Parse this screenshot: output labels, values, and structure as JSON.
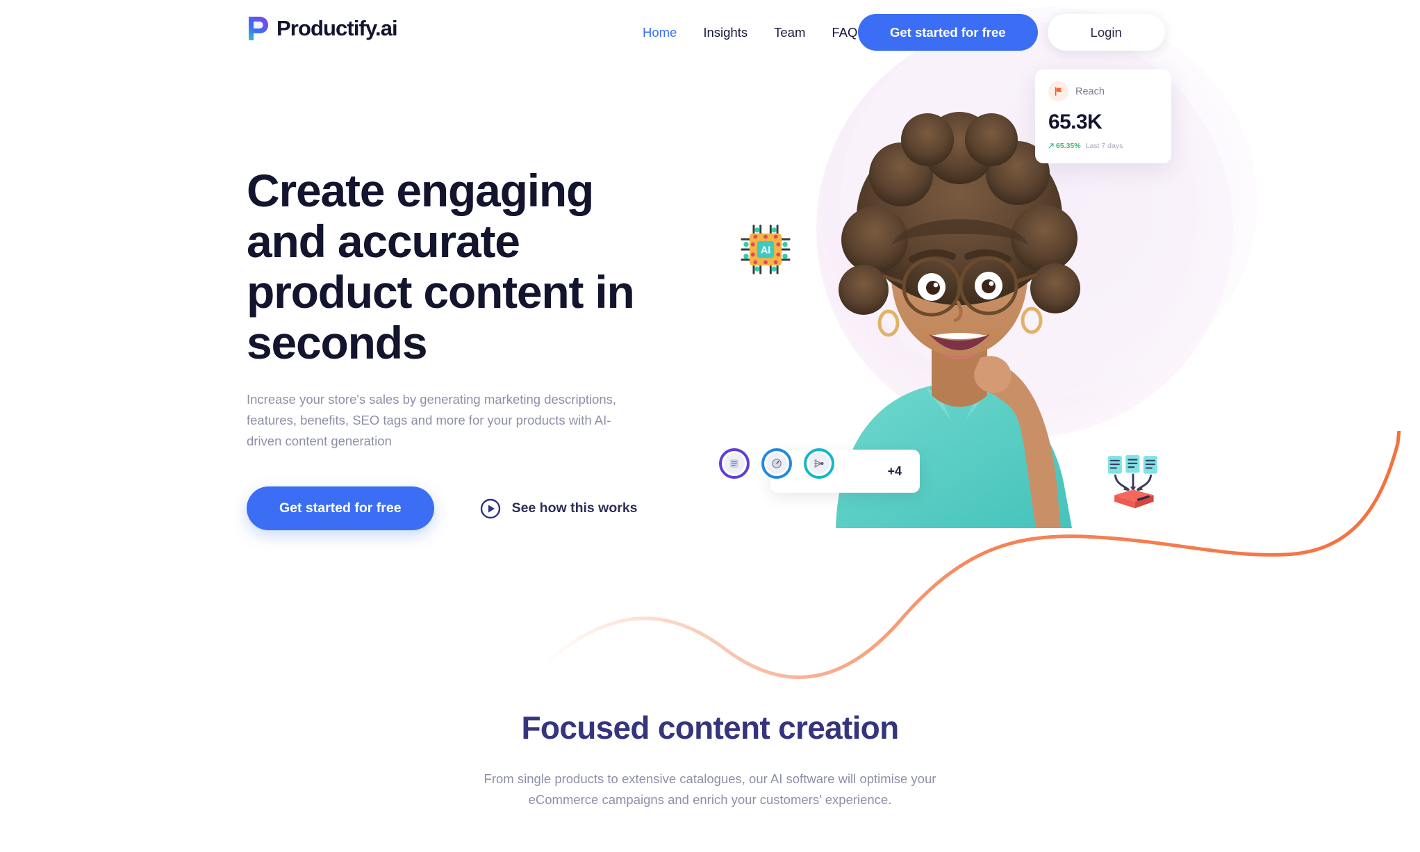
{
  "brand": {
    "name": "Productify.ai",
    "logo_icon": "productify-p-logo-icon",
    "accent_blue": "#3b6ef5",
    "headline_navy": "#13142e",
    "section_indigo": "#35357f",
    "muted_text": "#8d8fa8",
    "wave_orange": "#f4703c"
  },
  "header": {
    "nav": [
      {
        "label": "Home",
        "active": true
      },
      {
        "label": "Insights",
        "active": false
      },
      {
        "label": "Team",
        "active": false
      },
      {
        "label": "FAQ",
        "active": false
      }
    ],
    "cta_label": "Get started for free",
    "login_label": "Login"
  },
  "hero": {
    "title": "Create engaging and accurate product content in seconds",
    "subtitle": "Increase your store's sales by generating marketing descriptions, features, benefits, SEO tags and more for your products with AI-driven content generation",
    "primary_cta": "Get started for free",
    "video_link": "See how this works",
    "play_icon": "play-circle-icon",
    "person_image": "excited-woman-with-glasses-photo",
    "chip_icon": "ai-chip-icon",
    "docs_icon": "documents-to-database-icon"
  },
  "stat_card": {
    "icon": "orange-flag-icon",
    "label": "Reach",
    "value": "65.3K",
    "delta_arrow": "▲",
    "delta": "65.35%",
    "period": "Last 7 days",
    "delta_color": "#3cb878"
  },
  "avatars": {
    "items": [
      {
        "name": "avatar-1",
        "ring_color": "#5b3fd8"
      },
      {
        "name": "avatar-2",
        "ring_color": "#1f8ae0"
      },
      {
        "name": "avatar-3",
        "ring_color": "#18b6c9"
      }
    ],
    "more_label": "+4"
  },
  "section": {
    "title": "Focused content creation",
    "subtitle": "From single products to extensive catalogues, our AI software will optimise your eCommerce campaigns and enrich your customers' experience."
  }
}
